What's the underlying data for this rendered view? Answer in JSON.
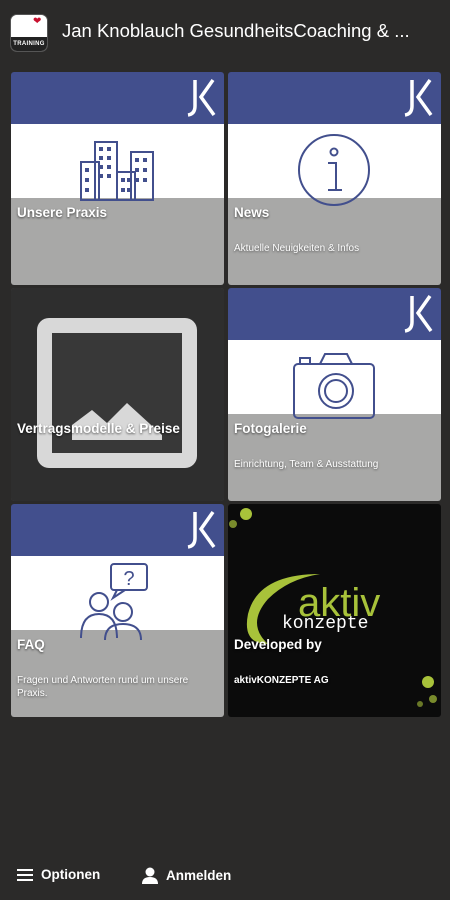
{
  "header": {
    "title": "Jan Knoblauch GesundheitsCoaching & ...",
    "app_icon_text": "TRAINING"
  },
  "tiles": [
    {
      "label": "Unsere Praxis",
      "subtitle": "",
      "icon": "office-buildings-icon"
    },
    {
      "label": "News",
      "subtitle": "Aktuelle Neuigkeiten & Infos",
      "icon": "info-icon"
    },
    {
      "label": "Vertragsmodelle & Preise",
      "subtitle": "",
      "icon": "image-placeholder-icon"
    },
    {
      "label": "Fotogalerie",
      "subtitle": "Einrichtung, Team & Ausstattung",
      "icon": "camera-icon"
    },
    {
      "label": "FAQ",
      "subtitle": "Fragen und Antworten rund um unsere Praxis.",
      "icon": "question-people-icon"
    },
    {
      "label": "Developed by",
      "subtitle": "aktivKONZEPTE AG",
      "icon": "aktiv-konzepte-logo"
    }
  ],
  "logo": {
    "line1": "aktiv",
    "line2": "konzepte"
  },
  "footer": {
    "options_label": "Optionen",
    "login_label": "Anmelden"
  },
  "colors": {
    "background": "#2b2a29",
    "band": "#424f8d",
    "tile_gray": "#a8a8a7",
    "logo_green": "#a8c23a"
  }
}
